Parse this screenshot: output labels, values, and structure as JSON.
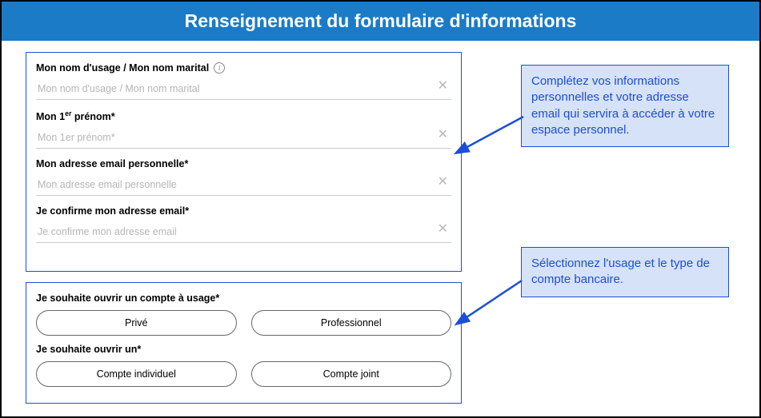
{
  "header": {
    "title": "Renseignement du formulaire d'informations"
  },
  "form_top": {
    "name_label": "Mon nom d'usage / Mon nom marital",
    "name_placeholder": "Mon nom d'usage / Mon nom marital",
    "firstname_label_prefix": "Mon 1",
    "firstname_label_sup": "er",
    "firstname_label_suffix": " prénom*",
    "firstname_placeholder": "Mon 1er prénom*",
    "email_label": "Mon adresse email personnelle*",
    "email_placeholder": "Mon adresse email personnelle",
    "email_confirm_label": "Je confirme mon adresse email*",
    "email_confirm_placeholder": "Je confirme mon adresse email"
  },
  "form_bottom": {
    "usage_label": "Je souhaite ouvrir un compte à usage*",
    "usage_options": {
      "private": "Privé",
      "pro": "Professionnel"
    },
    "type_label": "Je souhaite ouvrir un*",
    "type_options": {
      "indiv": "Compte individuel",
      "joint": "Compte joint"
    }
  },
  "callouts": {
    "top": "Complétez vos informations personnelles et votre adresse email qui servira à accéder à votre espace personnel.",
    "bottom": "Sélectionnez l'usage et le type de compte bancaire."
  },
  "colors": {
    "accent_blue": "#1b4fd6",
    "header_blue": "#1b7bc7",
    "callout_bg": "#d6e2f7"
  }
}
